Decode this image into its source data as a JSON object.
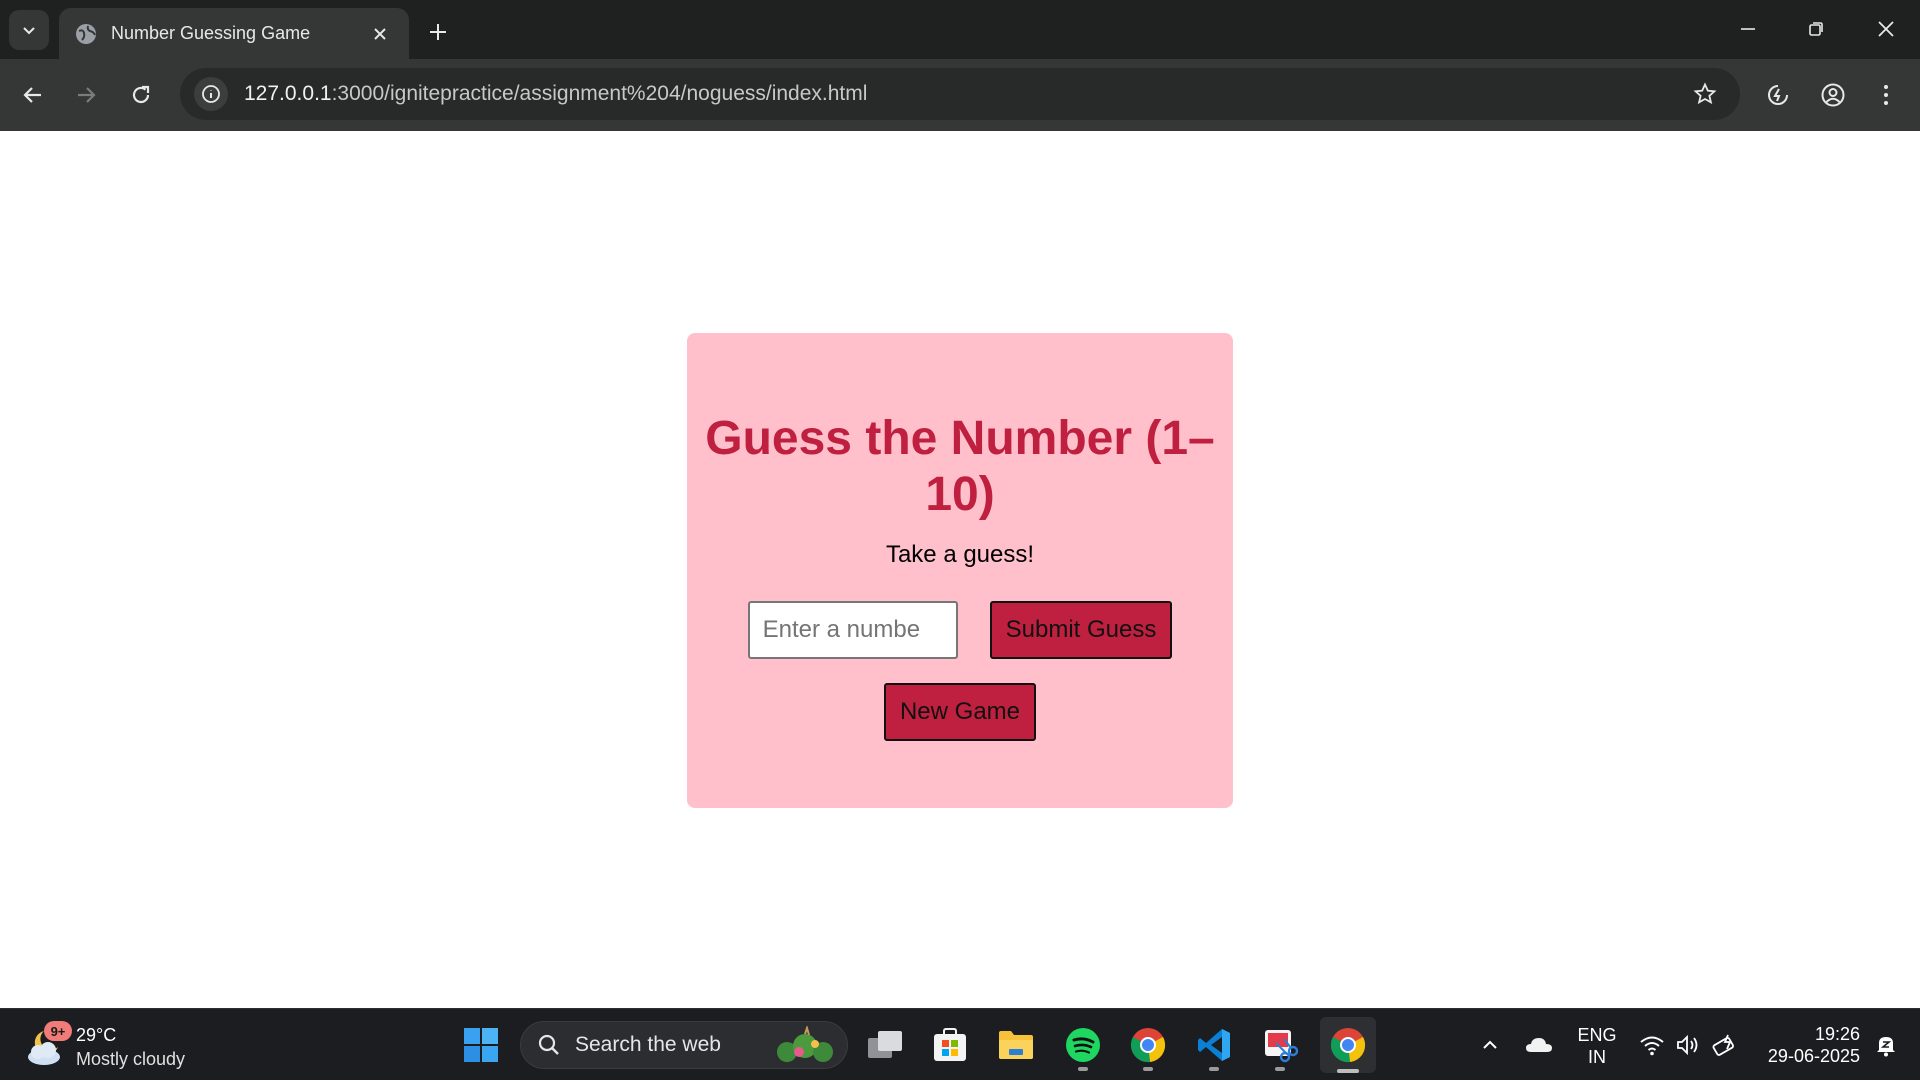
{
  "browser": {
    "tab": {
      "title": "Number Guessing Game",
      "favicon": "globe-icon"
    },
    "new_tab_icon": "plus-icon",
    "window_controls": [
      "minimize-icon",
      "restore-icon",
      "close-icon"
    ],
    "address": {
      "host": "127.0.0.1",
      "rest": ":3000/ignitepractice/assignment%204/noguess/index.html"
    }
  },
  "game": {
    "title": "Guess the Number (1–10)",
    "message": "Take a guess!",
    "input_placeholder": "Enter a numbe",
    "submit_label": "Submit Guess",
    "new_game_label": "New Game",
    "colors": {
      "card": "#ffc0cb",
      "accent": "#c0203f"
    }
  },
  "taskbar": {
    "weather": {
      "badge": "9+",
      "temp": "29°C",
      "desc": "Mostly cloudy"
    },
    "search_placeholder": "Search the web",
    "apps": [
      "task-view",
      "microsoft-store",
      "file-explorer",
      "spotify",
      "chrome",
      "vscode",
      "snipping-tool",
      "chrome-active"
    ],
    "lang": {
      "line1": "ENG",
      "line2": "IN"
    },
    "clock": {
      "time": "19:26",
      "date": "29-06-2025"
    }
  }
}
